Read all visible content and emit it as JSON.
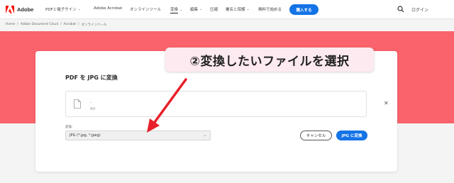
{
  "header": {
    "brand": "Adobe",
    "nav": [
      {
        "label": "PDFと電子サイン",
        "chevron": true
      },
      {
        "label": "Adobe Acrobat",
        "chevron": false
      },
      {
        "label": "オンラインツール",
        "chevron": false
      },
      {
        "label": "変換",
        "chevron": true,
        "active": true
      },
      {
        "label": "編集",
        "chevron": true
      },
      {
        "label": "圧縮",
        "chevron": false
      },
      {
        "label": "署名と保護",
        "chevron": true
      },
      {
        "label": "無料で始める",
        "chevron": false
      }
    ],
    "buy_label": "購入する",
    "login_label": "ログイン",
    "chevron_glyph": "⌄"
  },
  "breadcrumb": [
    "Home",
    "/",
    "Adobe Document Cloud",
    "/",
    "Acrobat",
    "/",
    "オンラインツール"
  ],
  "card": {
    "title": "PDF を JPG に変換",
    "file_name": "-",
    "file_ext": "PDF",
    "convert_label": "変換:",
    "select_value": "JPG (*.jpg, *.jpeg)",
    "cancel_label": "キャンセル",
    "convert_button_label": "JPG に変換"
  },
  "annotation": {
    "callout_text": "②変換したいファイルを選択"
  },
  "colors": {
    "hero": "#fa636b",
    "accent": "#1473e6",
    "arrow": "#e8202a",
    "callout_bg": "#fdeaf0",
    "adobe_red": "#fa0f00"
  },
  "icons": {
    "logo": "adobe-logo-icon",
    "search": "search-icon",
    "file": "file-icon",
    "close": "close-icon",
    "dropdown": "chevron-down-icon"
  }
}
